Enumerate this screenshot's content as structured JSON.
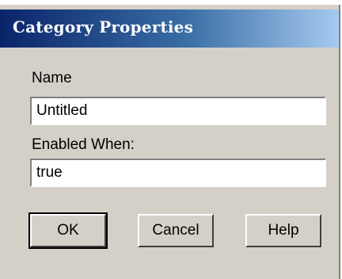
{
  "dialog": {
    "title": "Category Properties"
  },
  "form": {
    "name_label": "Name",
    "name_value": "Untitled",
    "enabled_label": "Enabled When:",
    "enabled_value": "true"
  },
  "buttons": {
    "ok": "OK",
    "cancel": "Cancel",
    "help": "Help"
  },
  "colors": {
    "face": "#d4d0c8",
    "title_start": "#0a246a",
    "title_end": "#a6caf0"
  }
}
